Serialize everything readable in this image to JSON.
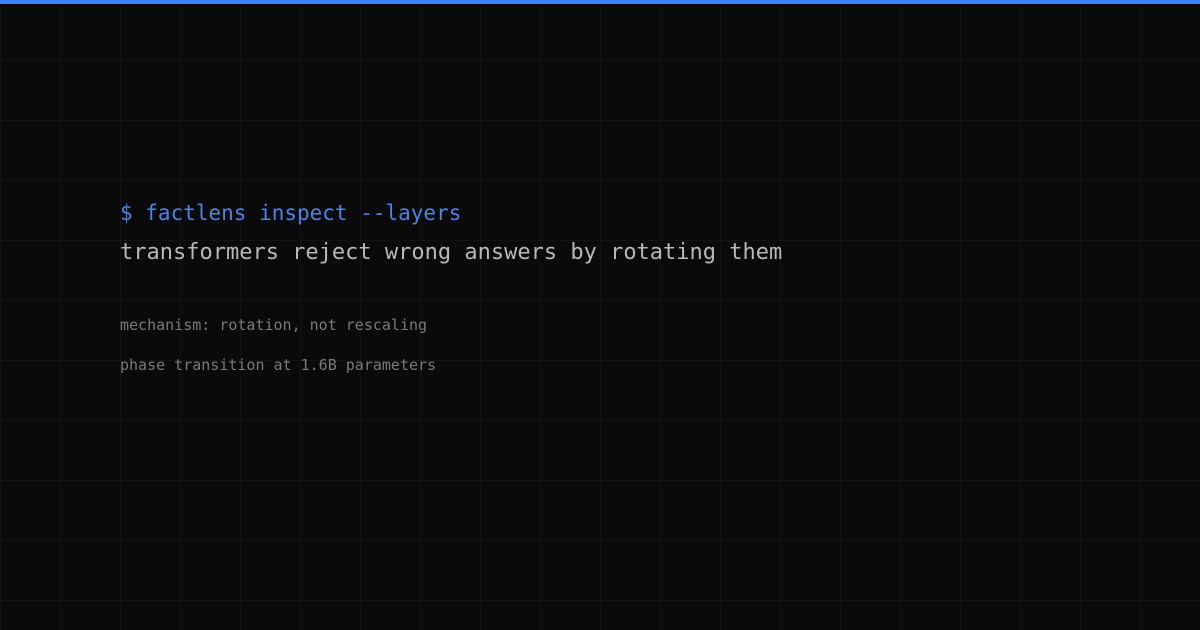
{
  "colors": {
    "background": "#0a0a0b",
    "accent": "#3b82f6",
    "command": "#4d82e6",
    "headline": "#b8b8b8",
    "detail": "#7a7a7a"
  },
  "terminal": {
    "command": "$ factlens inspect --layers",
    "headline": "transformers reject wrong answers by rotating them",
    "details": [
      "mechanism: rotation, not rescaling",
      "phase transition at 1.6B parameters"
    ]
  }
}
